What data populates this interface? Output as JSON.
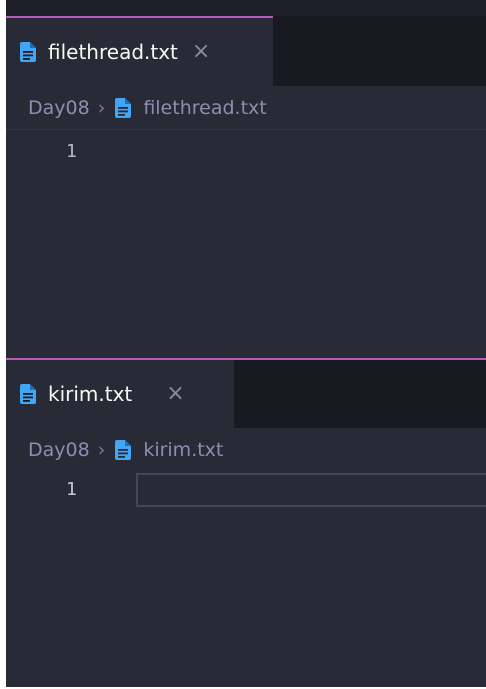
{
  "colors": {
    "background": "#282a36",
    "tabbar": "#191a21",
    "accent": "#b45bb5",
    "file_icon": "#42a5f5"
  },
  "panes": [
    {
      "tab": {
        "label": "filethread.txt",
        "close": "×",
        "icon": "file-text-icon"
      },
      "breadcrumb": {
        "folder": "Day08",
        "separator": "›",
        "file": "filethread.txt"
      },
      "lines": [
        "1"
      ]
    },
    {
      "tab": {
        "label": "kirim.txt",
        "close": "×",
        "icon": "file-text-icon"
      },
      "breadcrumb": {
        "folder": "Day08",
        "separator": "›",
        "file": "kirim.txt"
      },
      "lines": [
        "1"
      ]
    }
  ]
}
